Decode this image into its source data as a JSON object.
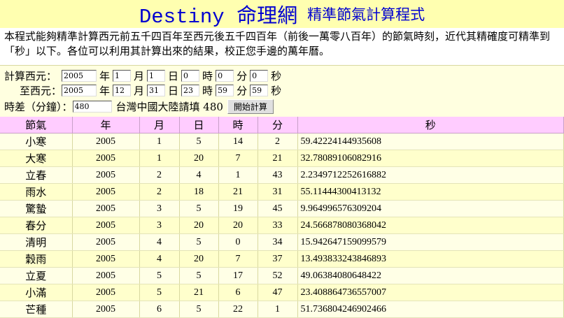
{
  "header": {
    "title": "Destiny 命理網",
    "subtitle": "精準節氣計算程式"
  },
  "intro": {
    "text": "本程式能夠精準計算西元前五千四百年至西元後五千四百年（前後一萬零八百年）的節氣時刻，近代其精確度可精準到「秒」以下。各位可以利用其計算出來的結果，校正您手邊的萬年曆。"
  },
  "form": {
    "from_label": "計算西元：",
    "to_label": "至西元：",
    "tz_label": "時差（分鐘）：",
    "tz_hint": "台灣中國大陸請填 480",
    "units": {
      "year": "年",
      "month": "月",
      "day": "日",
      "hour": "時",
      "minute": "分",
      "second": "秒"
    },
    "from": {
      "year": "2005",
      "month": "1",
      "day": "1",
      "hour": "0",
      "minute": "0",
      "second": "0"
    },
    "to": {
      "year": "2005",
      "month": "12",
      "day": "31",
      "hour": "23",
      "minute": "59",
      "second": "59"
    },
    "tz_value": "480",
    "start_button": "開始計算"
  },
  "table": {
    "headers": [
      "節氣",
      "年",
      "月",
      "日",
      "時",
      "分",
      "秒"
    ],
    "rows": [
      [
        "小寒",
        "2005",
        "1",
        "5",
        "14",
        "2",
        "59.42224144935608"
      ],
      [
        "大寒",
        "2005",
        "1",
        "20",
        "7",
        "21",
        "32.78089106082916"
      ],
      [
        "立春",
        "2005",
        "2",
        "4",
        "1",
        "43",
        "2.2349712252616882"
      ],
      [
        "雨水",
        "2005",
        "2",
        "18",
        "21",
        "31",
        "55.11444300413132"
      ],
      [
        "驚蟄",
        "2005",
        "3",
        "5",
        "19",
        "45",
        "9.964996576309204"
      ],
      [
        "春分",
        "2005",
        "3",
        "20",
        "20",
        "33",
        "24.566878080368042"
      ],
      [
        "清明",
        "2005",
        "4",
        "5",
        "0",
        "34",
        "15.942647159099579"
      ],
      [
        "穀雨",
        "2005",
        "4",
        "20",
        "7",
        "37",
        "13.493833243846893"
      ],
      [
        "立夏",
        "2005",
        "5",
        "5",
        "17",
        "52",
        "49.06384080648422"
      ],
      [
        "小滿",
        "2005",
        "5",
        "21",
        "6",
        "47",
        "23.408864736557007"
      ],
      [
        "芒種",
        "2005",
        "6",
        "5",
        "22",
        "1",
        "51.736804246902466"
      ]
    ]
  }
}
